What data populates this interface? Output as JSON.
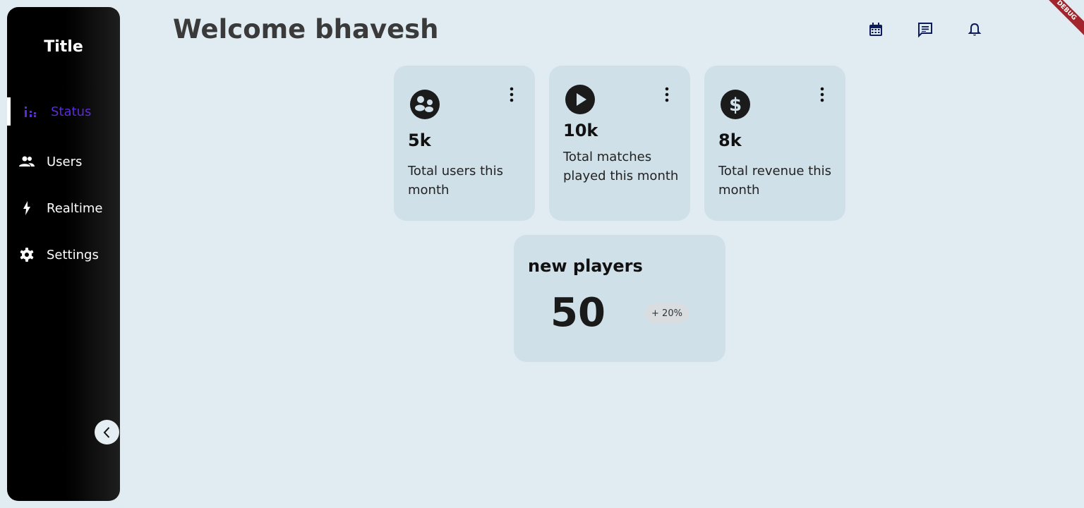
{
  "sidebar": {
    "title": "Title",
    "items": [
      {
        "label": "Status",
        "icon": "bar-chart-icon",
        "active": true
      },
      {
        "label": "Users",
        "icon": "people-icon",
        "active": false
      },
      {
        "label": "Realtime",
        "icon": "lightning-icon",
        "active": false
      },
      {
        "label": "Settings",
        "icon": "gear-icon",
        "active": false
      }
    ],
    "collapse_icon": "chevron-left-icon"
  },
  "header": {
    "welcome": "Welcome bhavesh",
    "icons": [
      "calendar-icon",
      "chat-icon",
      "bell-icon"
    ]
  },
  "debug_banner": "DEBUG",
  "stats": [
    {
      "icon": "community-icon",
      "value": "5k",
      "description": "Total users this month"
    },
    {
      "icon": "play-icon",
      "value": "10k",
      "description": "Total matches played this month"
    },
    {
      "icon": "dollar-icon",
      "value": "8k",
      "description": "Total revenue this month"
    }
  ],
  "new_players": {
    "title": "new players",
    "value": "50",
    "change": "+ 20%"
  },
  "colors": {
    "background": "#e0ecf2",
    "card": "#d0e0e8",
    "active": "#5b2bd9",
    "header_icon": "#0d1a5c"
  }
}
